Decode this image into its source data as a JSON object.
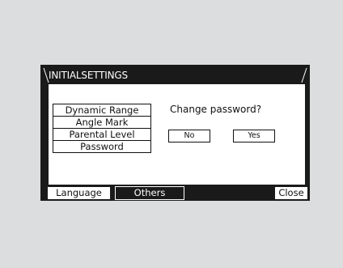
{
  "window": {
    "title": "INITIALSETTINGS"
  },
  "menu": {
    "items": [
      {
        "label": "Dynamic Range"
      },
      {
        "label": "Angle Mark"
      },
      {
        "label": "Parental Level"
      },
      {
        "label": "Password"
      }
    ]
  },
  "dialog": {
    "prompt": "Change password?",
    "no_label": "No",
    "yes_label": "Yes"
  },
  "tabs": {
    "language": "Language",
    "others": "Others",
    "close": "Close"
  },
  "colors": {
    "screen_bg": "#1a1a1a",
    "panel_bg": "#ffffff",
    "page_bg": "#dcdddf"
  }
}
